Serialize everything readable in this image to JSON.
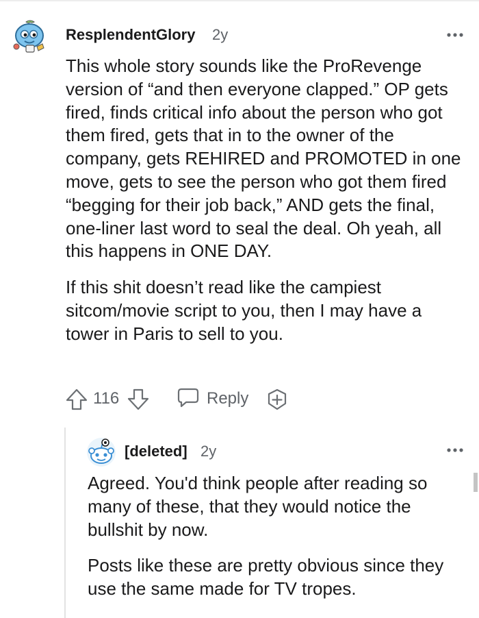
{
  "comment": {
    "username": "ResplendentGlory",
    "age": "2y",
    "avatar_icon": "blue-snoo-creature-avatar",
    "paragraphs": [
      "This whole story sounds like the ProRevenge version of “and then everyone clapped.” OP gets fired, finds critical info about the person who got them fired, gets that in to the owner of the company, gets REHIRED and PROMOTED in one move, gets to see the person who got them fired “begging for their job back,” AND gets the final, one-liner last word to seal the deal. Oh yeah, all this happens in ONE DAY.",
      "If this shit doesn’t read like the campiest sitcom/movie script to you, then I may have a tower in Paris to sell to you."
    ],
    "score": "116",
    "reply_label": "Reply",
    "icons": {
      "upvote": "upvote-arrow-icon",
      "downvote": "downvote-arrow-icon",
      "reply": "speech-bubble-icon",
      "award": "award-plus-icon",
      "more": "more-options-icon"
    }
  },
  "reply": {
    "username": "[deleted]",
    "age": "2y",
    "avatar_icon": "deleted-user-snoo-avatar",
    "paragraphs": [
      "Agreed. You'd think people after reading so many of these, that they would notice the bullshit by now.",
      "Posts like these are pretty obvious since they use the same made for TV tropes."
    ]
  },
  "colors": {
    "text": "#1a1a1b",
    "meta": "#5f6368",
    "icon": "#6b6f73",
    "thread_line": "#e2e2e2",
    "avatar_blue": "#4aa3df"
  }
}
